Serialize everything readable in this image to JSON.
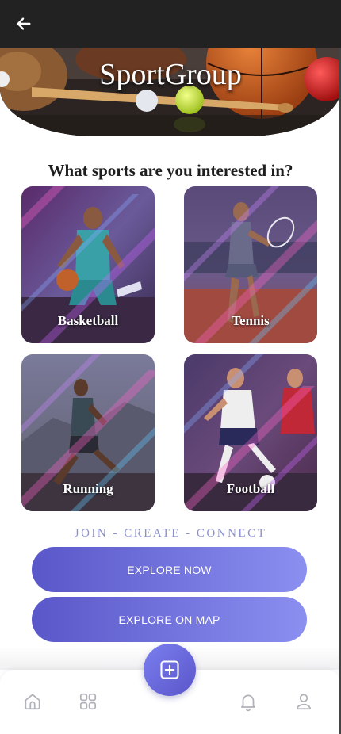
{
  "app": {
    "title": "SportGroup",
    "back_icon": "arrow-left-icon"
  },
  "main": {
    "question": "What sports are you interested in?",
    "sports": [
      {
        "label": "Basketball",
        "icon": "basketball-player-image"
      },
      {
        "label": "Tennis",
        "icon": "tennis-player-image"
      },
      {
        "label": "Running",
        "icon": "runner-image"
      },
      {
        "label": "Football",
        "icon": "football-players-image"
      }
    ],
    "tagline": "JOIN - CREATE - CONNECT",
    "explore_now_label": "EXPLORE NOW",
    "explore_map_label": "EXPLORE ON MAP"
  },
  "nav": {
    "items": [
      {
        "icon": "home-icon"
      },
      {
        "icon": "grid-icon"
      },
      {
        "icon": "add-icon"
      },
      {
        "icon": "bell-icon"
      },
      {
        "icon": "user-icon"
      }
    ]
  },
  "colors": {
    "topbar": "#222222",
    "accent_start": "#5a57c9",
    "accent_end": "#8a8ff0",
    "tagline": "#8a8fcf"
  }
}
